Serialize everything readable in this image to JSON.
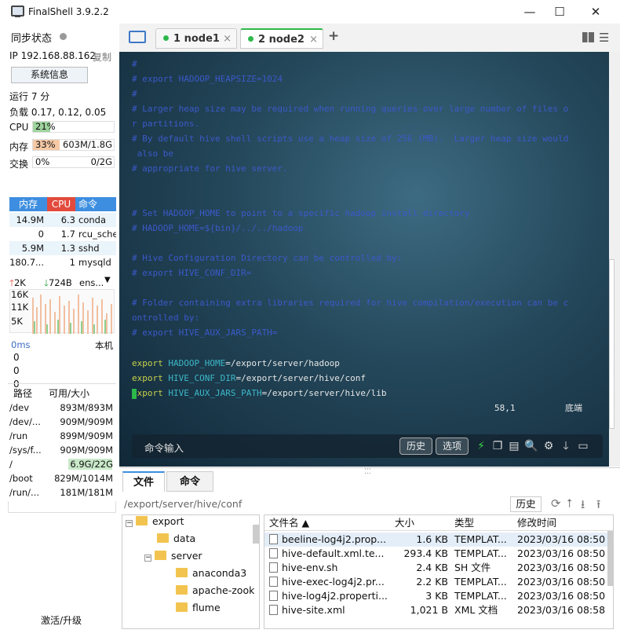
{
  "window": {
    "title": "FinalShell 3.9.2.2",
    "min": "—",
    "max": "☐",
    "close": "✕"
  },
  "left": {
    "sync_label": "同步状态",
    "ip": "IP 192.168.88.162",
    "copy": "复制",
    "sysinfo_button": "系统信息",
    "uptime": "运行 7 分",
    "load": "负载 0.17, 0.12, 0.05",
    "cpu": {
      "label": "CPU",
      "value": "21%",
      "percent": 21
    },
    "mem": {
      "label": "内存",
      "value": "33%",
      "detail": "603M/1.8G",
      "percent": 33
    },
    "swap": {
      "label": "交换",
      "value": "0%",
      "detail": "0/2G",
      "percent": 0
    },
    "proc_headers": [
      "内存",
      "CPU",
      "命令"
    ],
    "procs": [
      {
        "mem": "14.9M",
        "cpu": "6.3",
        "cmd": "conda"
      },
      {
        "mem": "0",
        "cpu": "1.7",
        "cmd": "rcu_sche"
      },
      {
        "mem": "5.9M",
        "cpu": "1.3",
        "cmd": "sshd"
      },
      {
        "mem": "180.7...",
        "cpu": "1",
        "cmd": "mysqld"
      }
    ],
    "net": {
      "up": "2K",
      "down": "724B",
      "iface": "ens...",
      "ticks": [
        "16K",
        "11K",
        "5K"
      ]
    },
    "ping": {
      "label": "0ms",
      "host": "本机",
      "values": [
        "0",
        "0",
        "0"
      ]
    },
    "disk_headers": [
      "路径",
      "可用/大小"
    ],
    "disks": [
      {
        "path": "/dev",
        "size": "893M/893M"
      },
      {
        "path": "/dev/...",
        "size": "909M/909M"
      },
      {
        "path": "/run",
        "size": "899M/909M"
      },
      {
        "path": "/sys/f...",
        "size": "909M/909M"
      },
      {
        "path": "/",
        "size": "6.9G/22G"
      },
      {
        "path": "/boot",
        "size": "829M/1014M"
      },
      {
        "path": "/run/...",
        "size": "181M/181M"
      }
    ],
    "activate": "激活/升级"
  },
  "tabs": [
    {
      "label": "1 node1",
      "close": "×"
    },
    {
      "label": "2 node2",
      "close": "×"
    }
  ],
  "add_tab": "+",
  "terminal": {
    "lines": [
      "#",
      "# export HADOOP_HEAPSIZE=1024",
      "#",
      "# Larger heap size may be required when running queries over large number of files o",
      "r partitions.",
      "# By default hive shell scripts use a heap size of 256 (MB).  Larger heap size would",
      " also be",
      "# appropriate for hive server.",
      "",
      "",
      "# Set HADOOP_HOME to point to a specific hadoop install directory",
      "# HADOOP_HOME=${bin}/../../hadoop",
      "",
      "# Hive Configuration Directory can be controlled by:",
      "# export HIVE_CONF_DIR=",
      "",
      "# Folder containing extra libraries required for hive compilation/execution can be c",
      "ontrolled by:",
      "# export HIVE_AUX_JARS_PATH="
    ],
    "exports": [
      {
        "kw": "export",
        "var": "HADOOP_HOME",
        "val": "=/export/server/hadoop"
      },
      {
        "kw": "export",
        "var": "HIVE_CONF_DIR",
        "val": "=/export/server/hive/conf"
      },
      {
        "kw": "export",
        "var": "HIVE_AUX_JARS_PATH",
        "val": "=/export/server/hive/lib"
      }
    ],
    "position": "58,1",
    "scroll_status": "底端",
    "cmd_input": "命令输入",
    "history_button": "历史",
    "options_button": "选项"
  },
  "bottom": {
    "tab_files": "文件",
    "tab_commands": "命令",
    "path": "/export/server/hive/conf",
    "history_button": "历史",
    "tree": [
      {
        "label": "export",
        "level": 0
      },
      {
        "label": "data",
        "level": 1
      },
      {
        "label": "server",
        "level": 1
      },
      {
        "label": "anaconda3",
        "level": 2
      },
      {
        "label": "apache-zook",
        "level": 2
      },
      {
        "label": "flume",
        "level": 2
      }
    ],
    "file_headers": [
      "文件名 ▲",
      "大小",
      "类型",
      "修改时间"
    ],
    "files": [
      {
        "name": "beeline-log4j2.prop...",
        "size": "1.6 KB",
        "type": "TEMPLAT...",
        "time": "2023/03/16 08:50"
      },
      {
        "name": "hive-default.xml.te...",
        "size": "293.4 KB",
        "type": "TEMPLAT...",
        "time": "2023/03/16 08:50"
      },
      {
        "name": "hive-env.sh",
        "size": "2.4 KB",
        "type": "SH 文件",
        "time": "2023/03/16 08:50"
      },
      {
        "name": "hive-exec-log4j2.pr...",
        "size": "2.2 KB",
        "type": "TEMPLAT...",
        "time": "2023/03/16 08:50"
      },
      {
        "name": "hive-log4j2.properti...",
        "size": "3 KB",
        "type": "TEMPLAT...",
        "time": "2023/03/16 08:50"
      },
      {
        "name": "hive-site.xml",
        "size": "1,021 B",
        "type": "XML 文档",
        "time": "2023/03/16 08:58"
      }
    ]
  }
}
